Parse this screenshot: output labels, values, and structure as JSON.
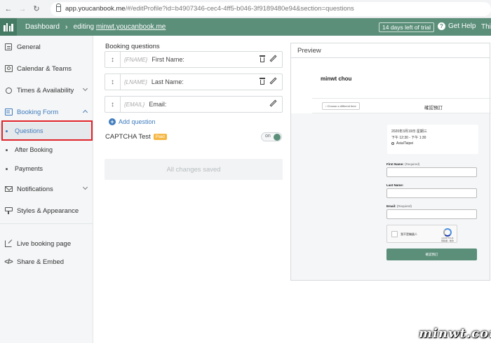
{
  "browser": {
    "url_host": "app.youcanbook.me",
    "url_rest": "/#/editProfile?id=b4907346-cec4-4ff5-b046-3f9189480e94&section=questions"
  },
  "header": {
    "dashboard": "Dashboard",
    "editing_prefix": "editing",
    "editing_link": "minwt.youcanbook.me",
    "trial": "14 days left of trial",
    "help": "Get Help",
    "overflow": "Thi",
    "accent_color": "#5b8f7a"
  },
  "sidebar": {
    "general": "General",
    "calendar": "Calendar & Teams",
    "times": "Times & Availability",
    "booking_form": "Booking Form",
    "questions": "Questions",
    "after_booking": "After Booking",
    "payments": "Payments",
    "notifications": "Notifications",
    "styles": "Styles & Appearance",
    "live_page": "Live booking page",
    "share": "Share & Embed"
  },
  "main": {
    "title": "Booking questions",
    "questions": [
      {
        "tag": "{FNAME}",
        "label": "First Name:"
      },
      {
        "tag": "{LNAME}",
        "label": "Last Name:"
      },
      {
        "tag": "{EMAIL}",
        "label": "Email:"
      }
    ],
    "add_question": "Add question",
    "captcha_label": "CAPTCHA Test",
    "paid_badge": "Paid",
    "toggle_state": "on",
    "saved_status": "All changes saved"
  },
  "preview": {
    "title": "Preview",
    "name": "minwt chou",
    "back": "Choose a different time",
    "confirm_title": "確認預訂",
    "date": "2020年3月19日 星期三",
    "time": "下午 12:30 - 下午 1:30",
    "timezone": "Asia/Taipei",
    "first_name_label": "First Name:",
    "last_name_label": "Last Name:",
    "email_label": "Email:",
    "required": "(Required)",
    "recaptcha_text": "我不是機器人",
    "recaptcha_brand": "reCAPTCHA",
    "recaptcha_terms": "隱私權 - 條款",
    "submit": "確認預訂"
  },
  "watermark": "minwt.com"
}
